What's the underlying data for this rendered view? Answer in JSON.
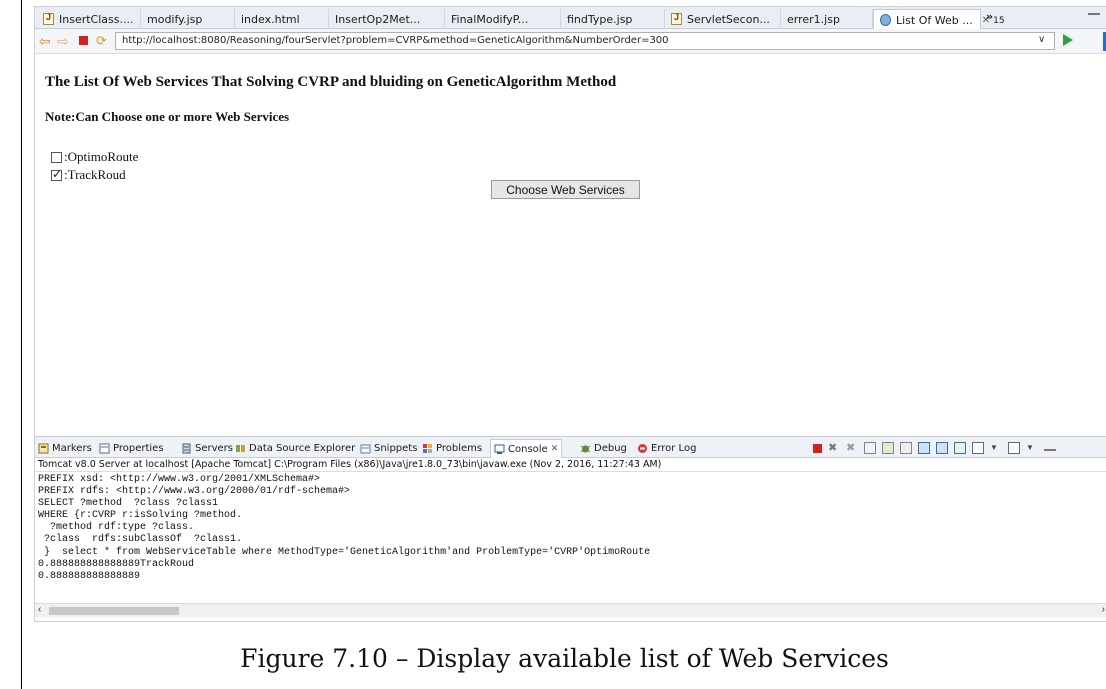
{
  "editor_tabs": [
    {
      "label": "InsertClass....",
      "icon": "java-file-icon"
    },
    {
      "label": "modify.jsp",
      "icon": "page-icon"
    },
    {
      "label": "index.html",
      "icon": "page-icon"
    },
    {
      "label": "InsertOp2Met...",
      "icon": "page-icon"
    },
    {
      "label": "FinalModifyP...",
      "icon": "page-icon"
    },
    {
      "label": "findType.jsp",
      "icon": "page-icon"
    },
    {
      "label": "ServletSecon...",
      "icon": "java-file-icon"
    },
    {
      "label": "errer1.jsp",
      "icon": "page-icon"
    },
    {
      "label": "List Of Web ...",
      "icon": "globe-icon",
      "active": true
    }
  ],
  "tabs_overflow": {
    "symbol": "»",
    "count": "15"
  },
  "browser": {
    "url": "http://localhost:8080/Reasoning/fourServlet?problem=CVRP&method=GeneticAlgorithm&NumberOrder=300"
  },
  "page": {
    "heading": "The List Of Web Services That Solving CVRP and bluiding on GeneticAlgorithm Method",
    "note": "Note:Can Choose one or more Web Services",
    "options": [
      {
        "label": ":OptimoRoute",
        "checked": false
      },
      {
        "label": ":TrackRoud",
        "checked": true
      }
    ],
    "button": "Choose Web Services"
  },
  "view_tabs": [
    {
      "label": "Markers"
    },
    {
      "label": "Properties"
    },
    {
      "label": "Servers"
    },
    {
      "label": "Data Source Explorer"
    },
    {
      "label": "Snippets"
    },
    {
      "label": "Problems"
    },
    {
      "label": "Console",
      "active": true
    },
    {
      "label": "Debug"
    },
    {
      "label": "Error Log"
    }
  ],
  "console": {
    "title": "Tomcat v8.0 Server at localhost [Apache Tomcat] C:\\Program Files (x86)\\Java\\jre1.8.0_73\\bin\\javaw.exe (Nov 2, 2016, 11:27:43 AM)",
    "lines": [
      "PREFIX xsd: <http://www.w3.org/2001/XMLSchema#>",
      "PREFIX rdfs: <http://www.w3.org/2000/01/rdf-schema#>",
      "SELECT ?method  ?class ?class1",
      "WHERE {r:CVRP r:isSolving ?method.",
      "  ?method rdf:type ?class.",
      " ?class  rdfs:subClassOf  ?class1.",
      " }  select * from WebServiceTable where MethodType='GeneticAlgorithm'and ProblemType='CVRP'OptimoRoute",
      "0.888888888888889TrackRoud",
      "0.888888888888889"
    ]
  },
  "caption": "Figure 7.10 – Display available list of Web Services"
}
